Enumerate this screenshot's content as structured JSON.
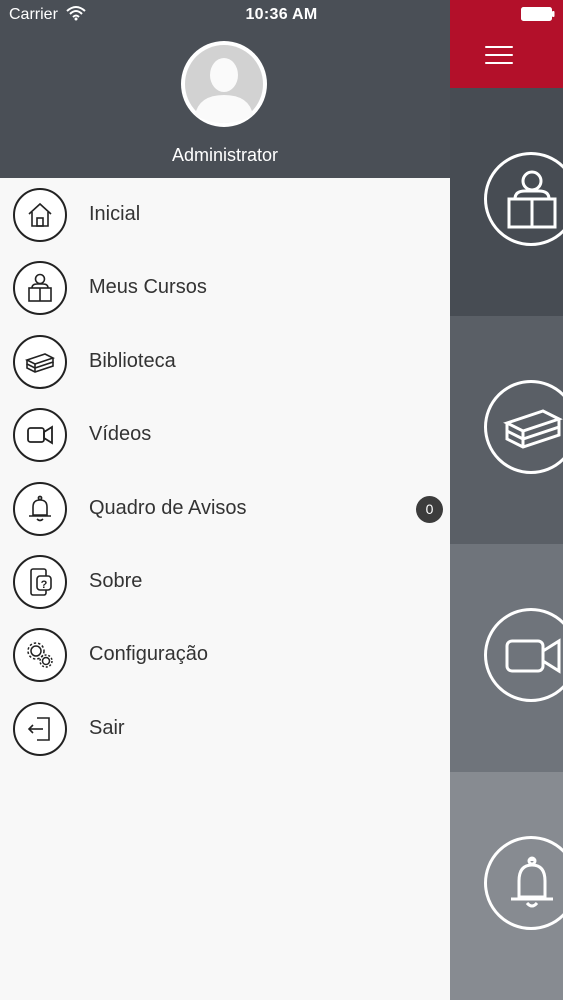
{
  "status_bar": {
    "carrier": "Carrier",
    "time": "10:36 AM"
  },
  "drawer": {
    "user": {
      "name": "Administrator"
    },
    "items": [
      {
        "label": "Inicial",
        "icon": "home-icon"
      },
      {
        "label": "Meus Cursos",
        "icon": "reader-icon"
      },
      {
        "label": "Biblioteca",
        "icon": "books-icon"
      },
      {
        "label": "Vídeos",
        "icon": "video-camera-icon"
      },
      {
        "label": "Quadro de Avisos",
        "icon": "bell-icon",
        "badge": "0"
      },
      {
        "label": "Sobre",
        "icon": "phone-question-icon"
      },
      {
        "label": "Configuração",
        "icon": "gears-icon"
      },
      {
        "label": "Sair",
        "icon": "exit-door-icon"
      }
    ]
  },
  "main": {
    "tiles": [
      {
        "icon": "reader-icon"
      },
      {
        "icon": "books-icon"
      },
      {
        "icon": "video-camera-icon"
      },
      {
        "icon": "bell-icon"
      }
    ]
  },
  "colors": {
    "accent": "#b3102a",
    "drawer_header": "#4a4f56",
    "drawer_bg": "#f8f8f8"
  }
}
